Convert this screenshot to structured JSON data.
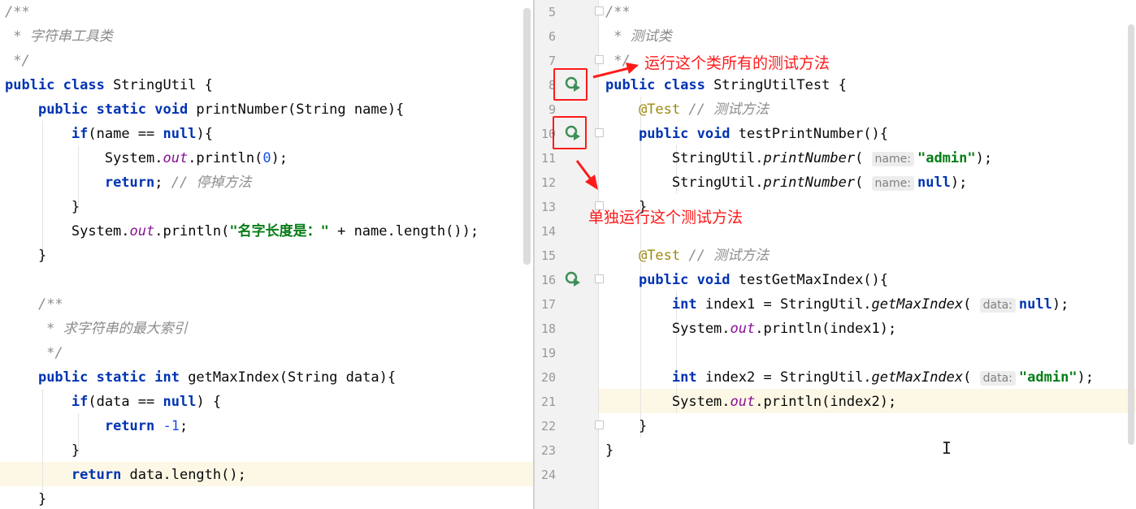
{
  "left_editor": {
    "lines": [
      [
        {
          "c": "cm",
          "t": "/**"
        }
      ],
      [
        {
          "c": "cm",
          "t": " * 字符串工具类"
        }
      ],
      [
        {
          "c": "cm",
          "t": " */"
        }
      ],
      [
        {
          "c": "kw",
          "t": "public class "
        },
        {
          "c": "",
          "t": "StringUtil {"
        }
      ],
      [
        {
          "c": "",
          "t": "    "
        },
        {
          "c": "kw",
          "t": "public static void "
        },
        {
          "c": "",
          "t": "printNumber(String name){"
        }
      ],
      [
        {
          "c": "",
          "t": "        "
        },
        {
          "c": "kw",
          "t": "if"
        },
        {
          "c": "",
          "t": "(name == "
        },
        {
          "c": "kw",
          "t": "null"
        },
        {
          "c": "",
          "t": "){"
        }
      ],
      [
        {
          "c": "",
          "t": "            System."
        },
        {
          "c": "fld",
          "t": "out"
        },
        {
          "c": "",
          "t": ".println("
        },
        {
          "c": "num",
          "t": "0"
        },
        {
          "c": "",
          "t": ");"
        }
      ],
      [
        {
          "c": "",
          "t": "            "
        },
        {
          "c": "kw",
          "t": "return"
        },
        {
          "c": "",
          "t": "; "
        },
        {
          "c": "cm",
          "t": "// 停掉方法"
        }
      ],
      [
        {
          "c": "",
          "t": "        }"
        }
      ],
      [
        {
          "c": "",
          "t": "        System."
        },
        {
          "c": "fld",
          "t": "out"
        },
        {
          "c": "",
          "t": ".println("
        },
        {
          "c": "str",
          "t": "\"名字长度是：\""
        },
        {
          "c": "",
          "t": " + name.length());"
        }
      ],
      [
        {
          "c": "",
          "t": "    }"
        }
      ],
      [
        {
          "c": "",
          "t": ""
        }
      ],
      [
        {
          "c": "",
          "t": "    "
        },
        {
          "c": "cm",
          "t": "/**"
        }
      ],
      [
        {
          "c": "cm",
          "t": "     * 求字符串的最大索引"
        }
      ],
      [
        {
          "c": "cm",
          "t": "     */"
        }
      ],
      [
        {
          "c": "",
          "t": "    "
        },
        {
          "c": "kw",
          "t": "public static int "
        },
        {
          "c": "",
          "t": "getMaxIndex(String data){"
        }
      ],
      [
        {
          "c": "",
          "t": "        "
        },
        {
          "c": "kw",
          "t": "if"
        },
        {
          "c": "",
          "t": "(data == "
        },
        {
          "c": "kw",
          "t": "null"
        },
        {
          "c": "",
          "t": ") {"
        }
      ],
      [
        {
          "c": "",
          "t": "            "
        },
        {
          "c": "kw",
          "t": "return "
        },
        {
          "c": "num",
          "t": "-1"
        },
        {
          "c": "",
          "t": ";"
        }
      ],
      [
        {
          "c": "",
          "t": "        }"
        }
      ],
      [
        {
          "c": "",
          "t": "        "
        },
        {
          "c": "kw",
          "t": "return "
        },
        {
          "c": "",
          "t": "data.length();"
        }
      ],
      [
        {
          "c": "",
          "t": "    }"
        }
      ]
    ]
  },
  "right_editor": {
    "line_numbers": [
      "5",
      "6",
      "7",
      "8",
      "9",
      "10",
      "11",
      "12",
      "13",
      "14",
      "15",
      "16",
      "17",
      "18",
      "19",
      "20",
      "21",
      "22",
      "23",
      "24"
    ],
    "lines": [
      [
        {
          "c": "cm",
          "t": "/**"
        }
      ],
      [
        {
          "c": "cm",
          "t": " * 测试类"
        }
      ],
      [
        {
          "c": "cm",
          "t": " */"
        }
      ],
      [
        {
          "c": "kw",
          "t": "public class "
        },
        {
          "c": "",
          "t": "StringUtilTest {"
        }
      ],
      [
        {
          "c": "",
          "t": "    "
        },
        {
          "c": "ann",
          "t": "@Test"
        },
        {
          "c": "",
          "t": " "
        },
        {
          "c": "cm",
          "t": "// 测试方法"
        }
      ],
      [
        {
          "c": "",
          "t": "    "
        },
        {
          "c": "kw",
          "t": "public void "
        },
        {
          "c": "",
          "t": "testPrintNumber(){"
        }
      ],
      [
        {
          "c": "",
          "t": "        StringUtil."
        },
        {
          "c": "stat",
          "t": "printNumber"
        },
        {
          "c": "",
          "t": "( "
        },
        {
          "c": "hint",
          "t": "name:"
        },
        {
          "c": "str",
          "t": "\"admin\""
        },
        {
          "c": "",
          "t": ");"
        }
      ],
      [
        {
          "c": "",
          "t": "        StringUtil."
        },
        {
          "c": "stat",
          "t": "printNumber"
        },
        {
          "c": "",
          "t": "( "
        },
        {
          "c": "hint",
          "t": "name:"
        },
        {
          "c": "kw",
          "t": "null"
        },
        {
          "c": "",
          "t": ");"
        }
      ],
      [
        {
          "c": "",
          "t": "    }"
        }
      ],
      [
        {
          "c": "",
          "t": ""
        }
      ],
      [
        {
          "c": "",
          "t": "    "
        },
        {
          "c": "ann",
          "t": "@Test"
        },
        {
          "c": "",
          "t": " "
        },
        {
          "c": "cm",
          "t": "// 测试方法"
        }
      ],
      [
        {
          "c": "",
          "t": "    "
        },
        {
          "c": "kw",
          "t": "public void "
        },
        {
          "c": "",
          "t": "testGetMaxIndex(){"
        }
      ],
      [
        {
          "c": "",
          "t": "        "
        },
        {
          "c": "kw",
          "t": "int "
        },
        {
          "c": "",
          "t": "index1 = StringUtil."
        },
        {
          "c": "stat",
          "t": "getMaxIndex"
        },
        {
          "c": "",
          "t": "( "
        },
        {
          "c": "hint",
          "t": "data:"
        },
        {
          "c": "kw",
          "t": "null"
        },
        {
          "c": "",
          "t": ");"
        }
      ],
      [
        {
          "c": "",
          "t": "        System."
        },
        {
          "c": "fld",
          "t": "out"
        },
        {
          "c": "",
          "t": ".println(index1);"
        }
      ],
      [
        {
          "c": "",
          "t": ""
        }
      ],
      [
        {
          "c": "",
          "t": "        "
        },
        {
          "c": "kw",
          "t": "int "
        },
        {
          "c": "",
          "t": "index2 = StringUtil."
        },
        {
          "c": "stat",
          "t": "getMaxIndex"
        },
        {
          "c": "",
          "t": "( "
        },
        {
          "c": "hint",
          "t": "data:"
        },
        {
          "c": "str",
          "t": "\"admin\""
        },
        {
          "c": "",
          "t": ");"
        }
      ],
      [
        {
          "c": "",
          "t": "        System."
        },
        {
          "c": "fld",
          "t": "out"
        },
        {
          "c": "",
          "t": ".println(index2);"
        }
      ],
      [
        {
          "c": "",
          "t": "    }"
        }
      ],
      [
        {
          "c": "",
          "t": "}"
        }
      ],
      [
        {
          "c": "",
          "t": ""
        }
      ]
    ]
  },
  "annotations": {
    "run_class_label": "运行这个类所有的测试方法",
    "run_method_label": "单独运行这个测试方法"
  },
  "colors": {
    "keyword": "#0033b3",
    "comment": "#8c8c8c",
    "string": "#067d17",
    "annotation": "#9e880d",
    "callout_red": "#ff1a1a",
    "run_icon_green": "#3d8f58"
  }
}
